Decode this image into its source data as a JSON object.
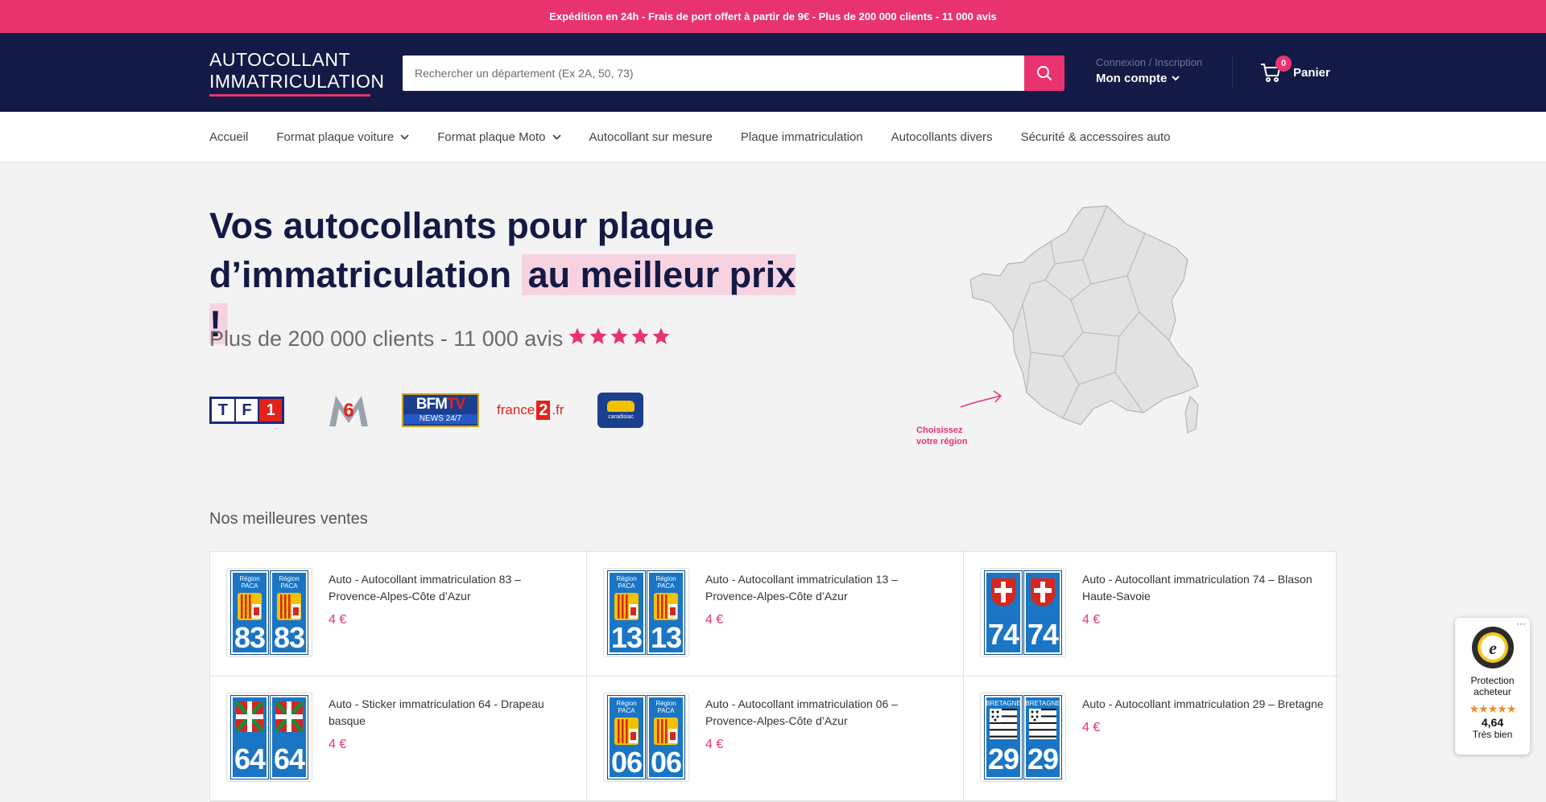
{
  "announcement": "Expédition en 24h - Frais de port offert à partir de 9€ - Plus de 200 000 clients - 11 000 avis",
  "header": {
    "logo_line1": "AUTOCOLLANT",
    "logo_line2": "IMMATRICULATION",
    "search_placeholder": "Rechercher un département (Ex 2A, 50, 73)",
    "account_small": "Connexion / Inscription",
    "account_label": "Mon compte",
    "cart_count": "0",
    "cart_label": "Panier"
  },
  "nav": {
    "items": [
      {
        "label": "Accueil"
      },
      {
        "label": "Format plaque voiture"
      },
      {
        "label": "Format plaque Moto"
      },
      {
        "label": "Autocollant sur mesure"
      },
      {
        "label": "Plaque immatriculation"
      },
      {
        "label": "Autocollants divers"
      },
      {
        "label": "Sécurité & accessoires auto"
      }
    ]
  },
  "hero": {
    "title_main": "Vos autocollants pour plaque d’immatriculation",
    "title_highlight": "au meilleur prix !",
    "clients_text": "Plus de 200 000 clients - 11 000 avis",
    "rating_stars": 5,
    "media_logos": [
      "TF1",
      "M6",
      "BFMTV NEWS 24/7",
      "france 2 .fr",
      "caradisiac.com"
    ],
    "map_hint": "Choisissez votre région"
  },
  "section_title": "Nos meilleures ventes",
  "products": [
    {
      "title": "Auto - Autocollant immatriculation 83 – Provence-Alpes-Côte d’Azur",
      "price": "4 €",
      "number": "83",
      "region": "Région PACA",
      "emblem": "paca"
    },
    {
      "title": "Auto - Autocollant immatriculation 13 – Provence-Alpes-Côte d’Azur",
      "price": "4 €",
      "number": "13",
      "region": "Région PACA",
      "emblem": "paca"
    },
    {
      "title": "Auto - Autocollant immatriculation 74 – Blason Haute-Savoie",
      "price": "4 €",
      "number": "74",
      "region": "",
      "emblem": "savoie"
    },
    {
      "title": "Auto - Sticker immatriculation 64 - Drapeau basque",
      "price": "4 €",
      "number": "64",
      "region": "",
      "emblem": "basque"
    },
    {
      "title": "Auto - Autocollant immatriculation 06 – Provence-Alpes-Côte d’Azur",
      "price": "4 €",
      "number": "06",
      "region": "Région PACA",
      "emblem": "paca"
    },
    {
      "title": "Auto - Autocollant immatriculation 29 – Bretagne",
      "price": "4 €",
      "number": "29",
      "region": "BRETAGNE",
      "emblem": "bretagne"
    }
  ],
  "trust_badge": {
    "label": "Protection acheteur",
    "score": "4,64",
    "rating_text": "Très bien"
  },
  "colors": {
    "accent": "#e8336f",
    "header_bg": "#131a45",
    "plate_blue": "#1a75c4"
  }
}
